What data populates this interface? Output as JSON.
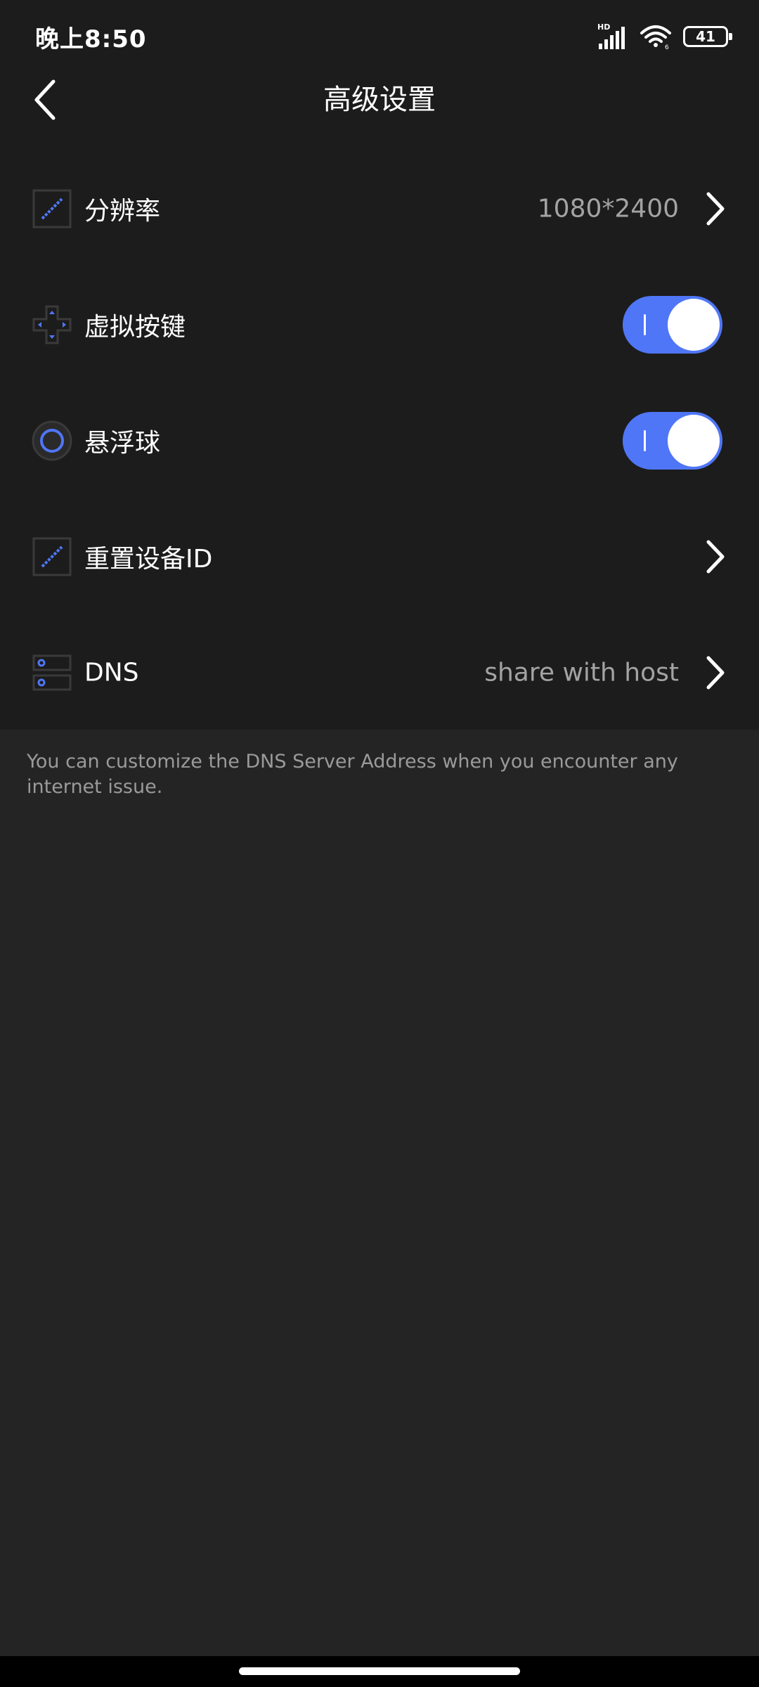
{
  "status_bar": {
    "time": "晚上8:50",
    "network_label": "HD",
    "battery": "41"
  },
  "header": {
    "title": "高级设置"
  },
  "settings": {
    "resolution": {
      "label": "分辨率",
      "value": "1080*2400"
    },
    "virtual_keys": {
      "label": "虚拟按键",
      "enabled": true
    },
    "floating_ball": {
      "label": "悬浮球",
      "enabled": true
    },
    "reset_device_id": {
      "label": "重置设备ID"
    },
    "dns": {
      "label": "DNS",
      "value": "share with host"
    }
  },
  "note": "You can customize the DNS Server Address when you encounter any internet issue.",
  "colors": {
    "accent": "#4f76f6",
    "background": "#242424",
    "panel": "#1c1c1c",
    "secondary_text": "#a3a3a3"
  },
  "icons": {
    "back": "chevron-left-icon",
    "resolution": "resolution-icon",
    "virtual_keys": "dpad-icon",
    "floating_ball": "floating-ball-icon",
    "reset_device_id": "device-id-icon",
    "dns": "server-icon",
    "chevron": "chevron-right-icon"
  }
}
